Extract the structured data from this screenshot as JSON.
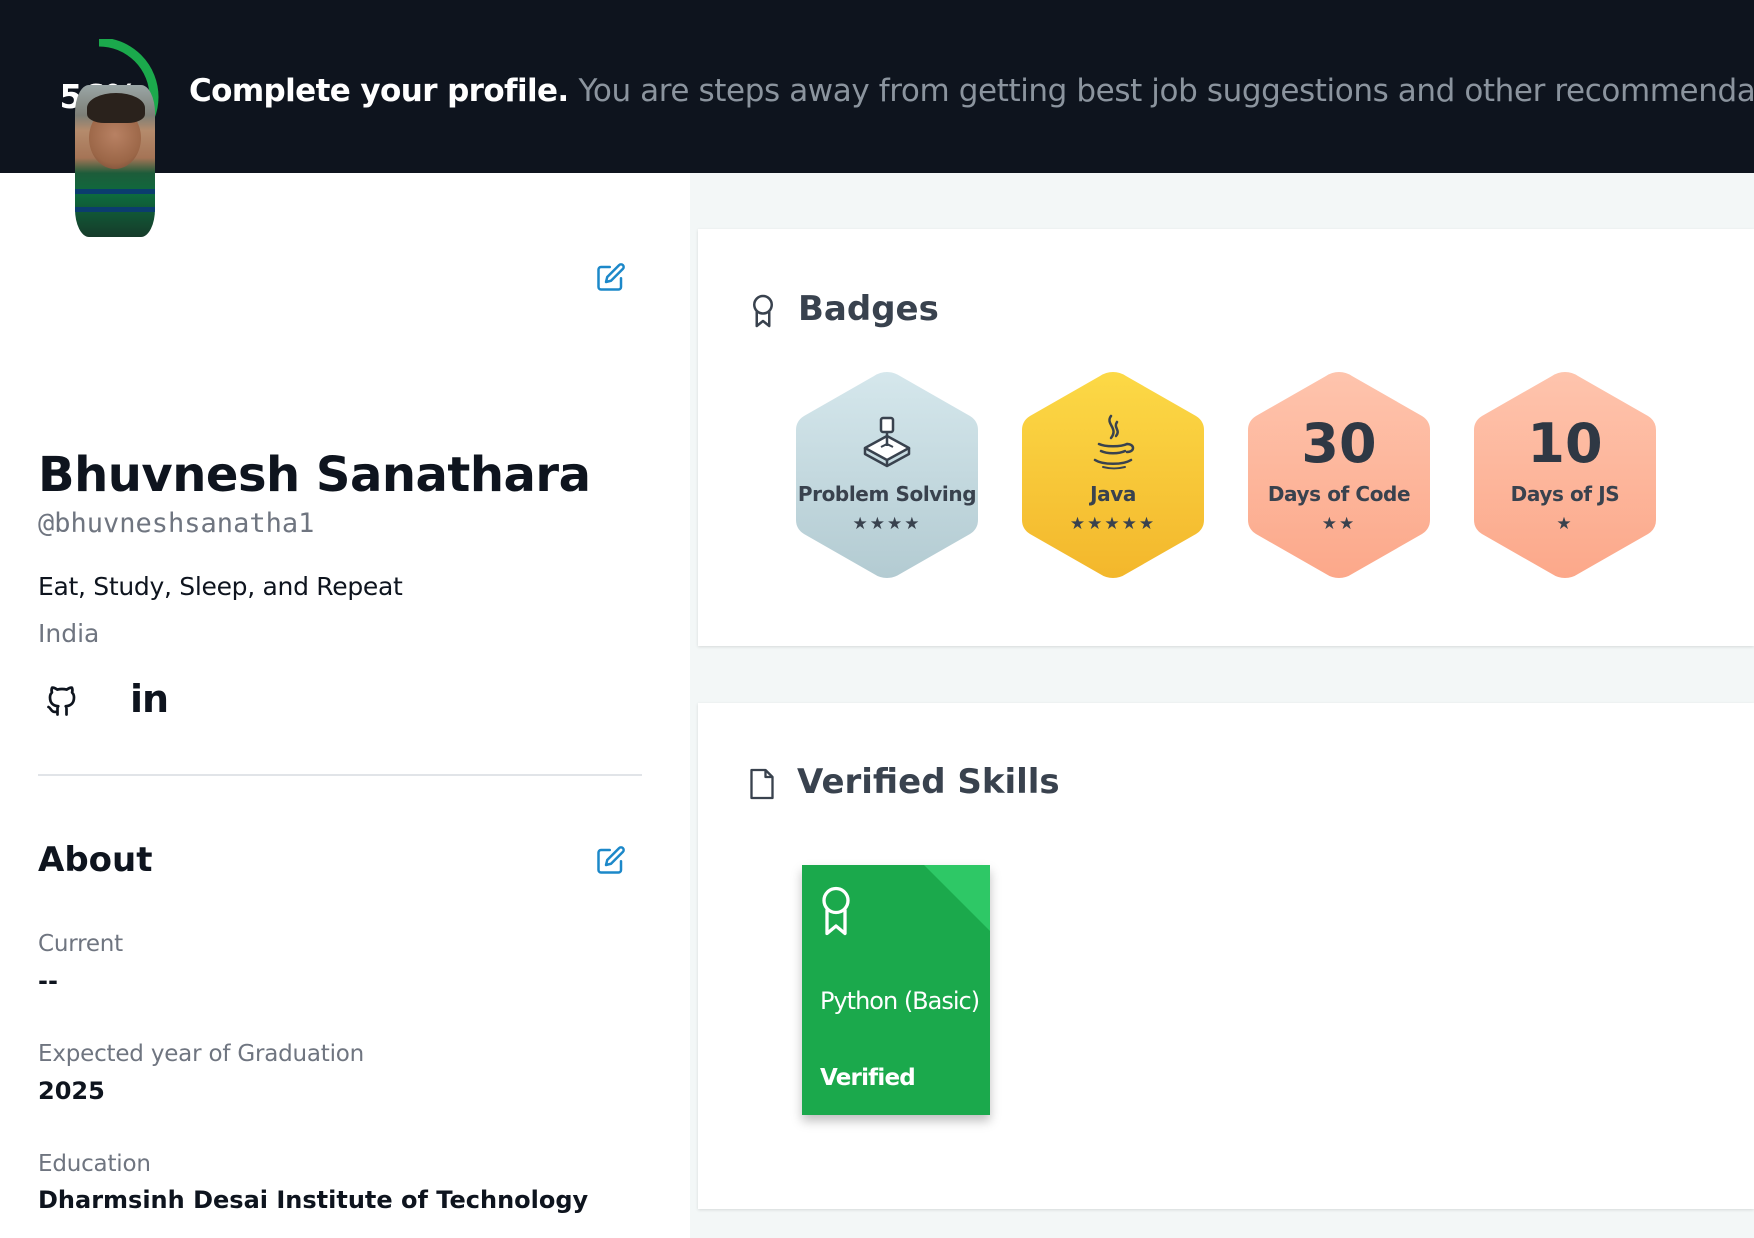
{
  "banner": {
    "percent_label": "56%",
    "percent_value": 56,
    "title": "Complete your profile.",
    "message": "You are steps away from getting best job suggestions and other recommendations.",
    "ring_color": "#1ba94c"
  },
  "profile": {
    "name": "Bhuvnesh Sanathara",
    "handle": "@bhuvneshsanatha1",
    "bio": "Eat, Study, Sleep, and Repeat",
    "country": "India",
    "social": {
      "github_icon": "github-icon",
      "linkedin_label": "in"
    }
  },
  "about": {
    "title": "About",
    "fields": [
      {
        "label": "Current",
        "value": "--"
      },
      {
        "label": "Expected year of Graduation",
        "value": "2025"
      },
      {
        "label": "Education",
        "value": "Dharmsinh Desai Institute of Technology"
      }
    ]
  },
  "badges": {
    "title": "Badges",
    "items": [
      {
        "label": "Problem Solving",
        "stars": "★★★★",
        "star_count": 4,
        "icon": "problem-solving-icon",
        "color": "#c9dde3"
      },
      {
        "label": "Java",
        "stars": "★★★★★",
        "star_count": 5,
        "icon": "java-icon",
        "color": "#f6c634"
      },
      {
        "number": "30",
        "label": "Days of Code",
        "stars": "★★",
        "star_count": 2,
        "color": "#fdb8a0"
      },
      {
        "number": "10",
        "label": "Days of JS",
        "stars": "★",
        "star_count": 1,
        "color": "#fdb8a0"
      }
    ]
  },
  "skills": {
    "title": "Verified Skills",
    "items": [
      {
        "name": "Python (Basic)",
        "status": "Verified",
        "color": "#1ba94c"
      }
    ]
  }
}
